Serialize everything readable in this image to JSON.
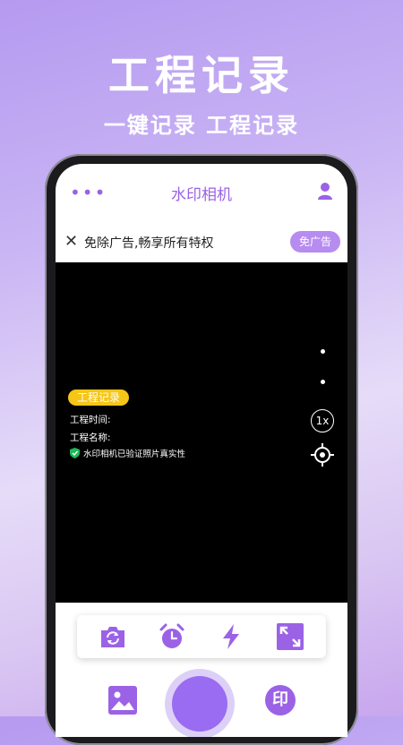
{
  "promo": {
    "title": "工程记录",
    "subtitle": "一键记录 工程记录"
  },
  "appbar": {
    "menu_icon": "more-dots-icon",
    "title": "水印相机",
    "user_icon": "user-icon"
  },
  "ad_bar": {
    "close_icon": "close-icon",
    "text": "免除广告,畅享所有特权",
    "button": "免广告"
  },
  "watermark": {
    "tag": "工程记录",
    "time_label": "工程时间:",
    "name_label": "工程名称:",
    "verify_text": "水印相机已验证照片真实性"
  },
  "camera_controls": {
    "zoom": "1x"
  },
  "toolbar": {
    "tools": [
      "camera-flip-icon",
      "alarm-timer-icon",
      "flash-icon",
      "expand-icon"
    ]
  },
  "bottom": {
    "gallery_icon": "gallery-icon",
    "watermark_btn": "印"
  },
  "colors": {
    "accent": "#9b62e6",
    "tag_yellow": "#f5c518",
    "shutter": "#9a6cf1"
  }
}
